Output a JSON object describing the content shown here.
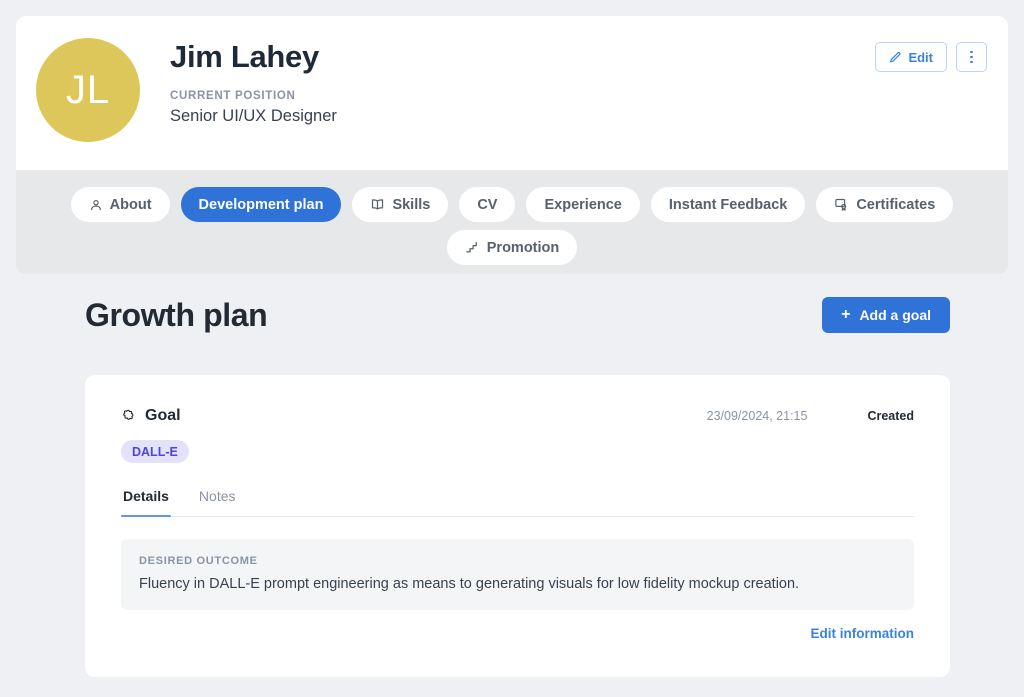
{
  "profile": {
    "initials": "JL",
    "name": "Jim Lahey",
    "position_label": "CURRENT POSITION",
    "position": "Senior UI/UX Designer",
    "edit_label": "Edit",
    "more_label": "More options"
  },
  "tabs": {
    "row1": [
      {
        "label": "About",
        "icon": "person-icon",
        "active": false
      },
      {
        "label": "Development plan",
        "icon": "",
        "active": true
      },
      {
        "label": "Skills",
        "icon": "book-icon",
        "active": false
      },
      {
        "label": "CV",
        "icon": "",
        "active": false
      },
      {
        "label": "Experience",
        "icon": "",
        "active": false
      },
      {
        "label": "Instant Feedback",
        "icon": "",
        "active": false
      },
      {
        "label": "Certificates",
        "icon": "certificate-icon",
        "active": false
      }
    ],
    "row2": [
      {
        "label": "Promotion",
        "icon": "stairs-icon",
        "active": false
      }
    ]
  },
  "section": {
    "title": "Growth plan",
    "add_goal_label": "Add a goal",
    "add_goal_plus": "+"
  },
  "goal": {
    "title": "Goal",
    "icon": "puzzle-icon",
    "timestamp": "23/09/2024, 21:15",
    "status": "Created",
    "badge": "DALL-E",
    "subtabs": [
      {
        "label": "Details",
        "active": true
      },
      {
        "label": "Notes",
        "active": false
      }
    ],
    "outcome_label": "DESIRED OUTCOME",
    "outcome_text": "Fluency in DALL-E prompt engineering as means to generating visuals for low fidelity mockup creation.",
    "edit_information_label": "Edit information"
  },
  "colors": {
    "page_bg": "#eef0f4",
    "nav_bg": "#e7e8ea",
    "accent_blue": "#2f73d8",
    "link_blue": "#3b82dd",
    "avatar_gold": "#ddc75b",
    "badge_bg": "#e3e2fa",
    "badge_text": "#4f46d8",
    "muted_text": "#8b93a3"
  }
}
